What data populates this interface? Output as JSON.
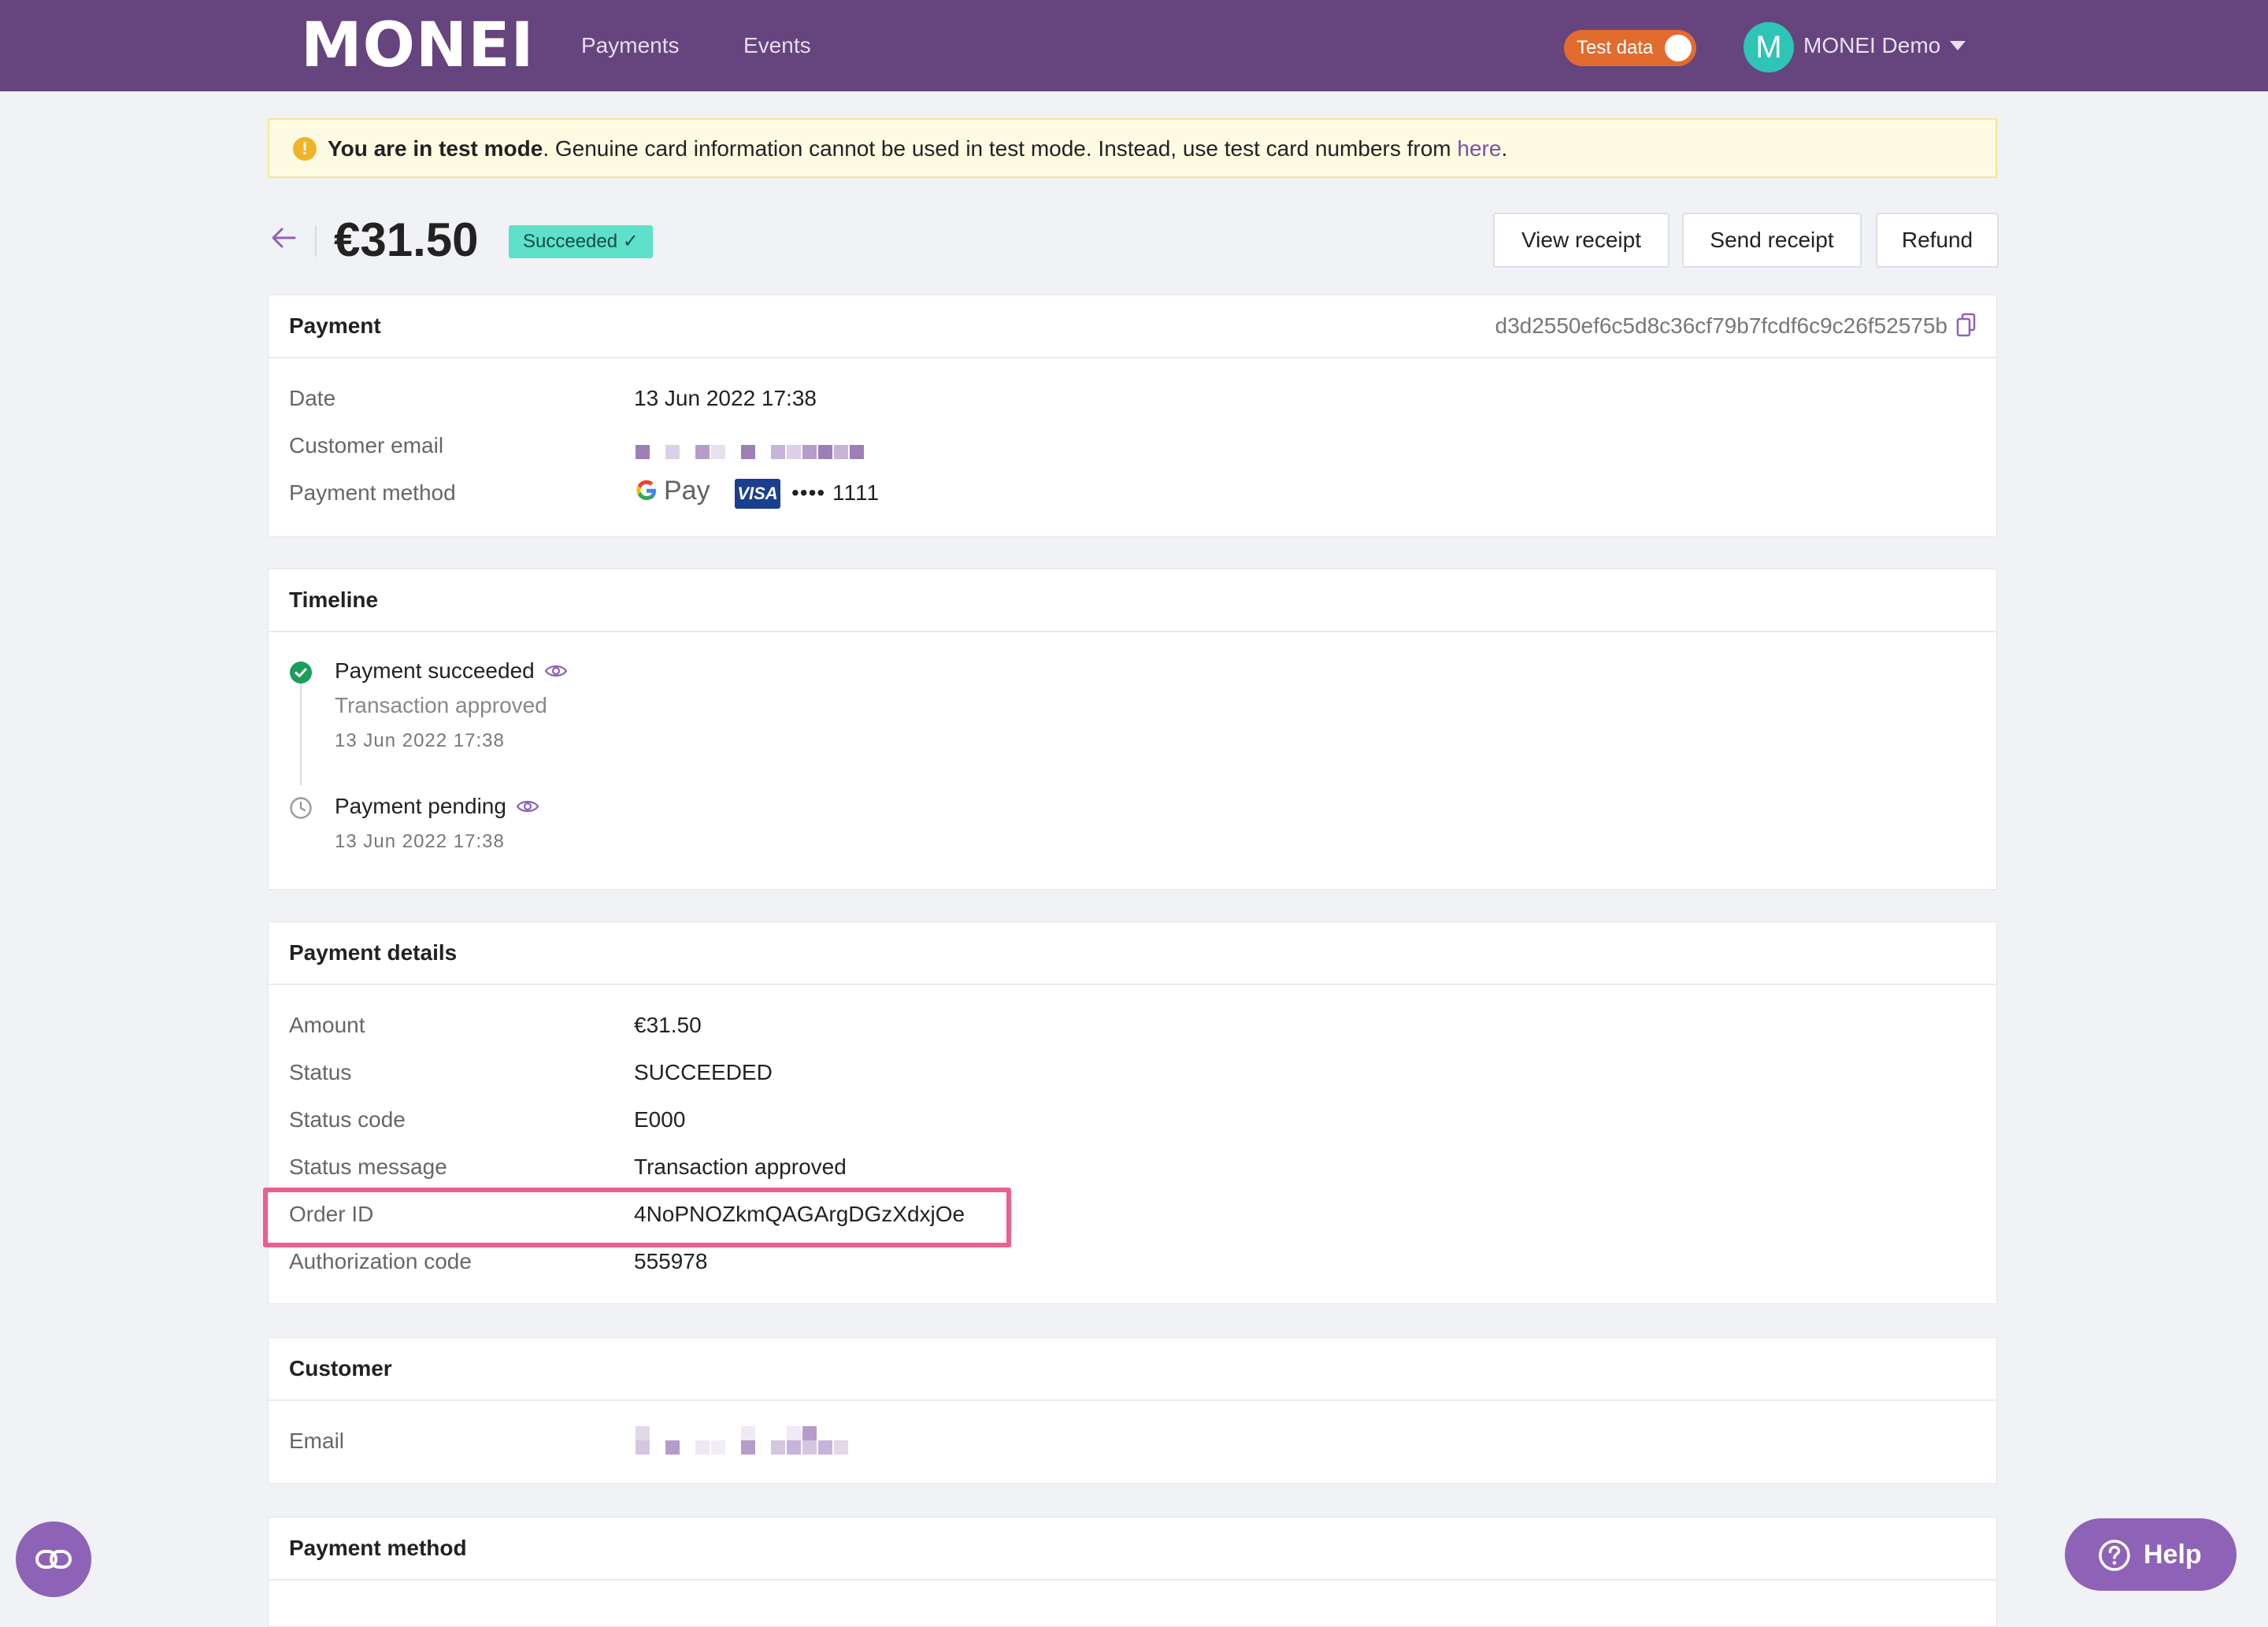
{
  "header": {
    "logo": "MONEI",
    "nav": [
      "Payments",
      "Events"
    ],
    "test_toggle_label": "Test data",
    "avatar_initial": "M",
    "account_name": "MONEI Demo"
  },
  "banner": {
    "bold": "You are in test mode",
    "text": ". Genuine card information cannot be used in test mode. Instead, use test card numbers from ",
    "link": "here",
    "end": "."
  },
  "summary": {
    "amount": "€31.50",
    "status_badge": "Succeeded ✓",
    "buttons": {
      "view_receipt": "View receipt",
      "send_receipt": "Send receipt",
      "refund": "Refund"
    }
  },
  "payment_card": {
    "title": "Payment",
    "payment_id": "d3d2550ef6c5d8c36cf79b7fcdf6c9c26f52575b",
    "rows": {
      "date_label": "Date",
      "date_value": "13 Jun 2022 17:38",
      "email_label": "Customer email",
      "method_label": "Payment method",
      "gpay_text": "Pay",
      "visa_text": "VISA",
      "card_masked": "•••• 1111"
    }
  },
  "timeline": {
    "title": "Timeline",
    "events": [
      {
        "title": "Payment succeeded",
        "subtitle": "Transaction approved",
        "date": "13 Jun 2022 17:38"
      },
      {
        "title": "Payment pending",
        "date": "13 Jun 2022 17:38"
      }
    ]
  },
  "payment_details": {
    "title": "Payment details",
    "rows": [
      {
        "label": "Amount",
        "value": "€31.50"
      },
      {
        "label": "Status",
        "value": "SUCCEEDED"
      },
      {
        "label": "Status code",
        "value": "E000"
      },
      {
        "label": "Status message",
        "value": "Transaction approved"
      },
      {
        "label": "Order ID",
        "value": "4NoPNOZkmQAGArgDGzXdxjOe"
      },
      {
        "label": "Authorization code",
        "value": "555978"
      }
    ]
  },
  "customer": {
    "title": "Customer",
    "email_label": "Email"
  },
  "payment_method_card": {
    "title": "Payment method"
  },
  "help": {
    "label": "Help"
  },
  "colors": {
    "brand": "#66447e",
    "accent": "#8e63b7",
    "success": "#1a9e5c",
    "badge": "#5fe0c8",
    "highlight": "#ec5f91",
    "toggle": "#e26b2e"
  }
}
